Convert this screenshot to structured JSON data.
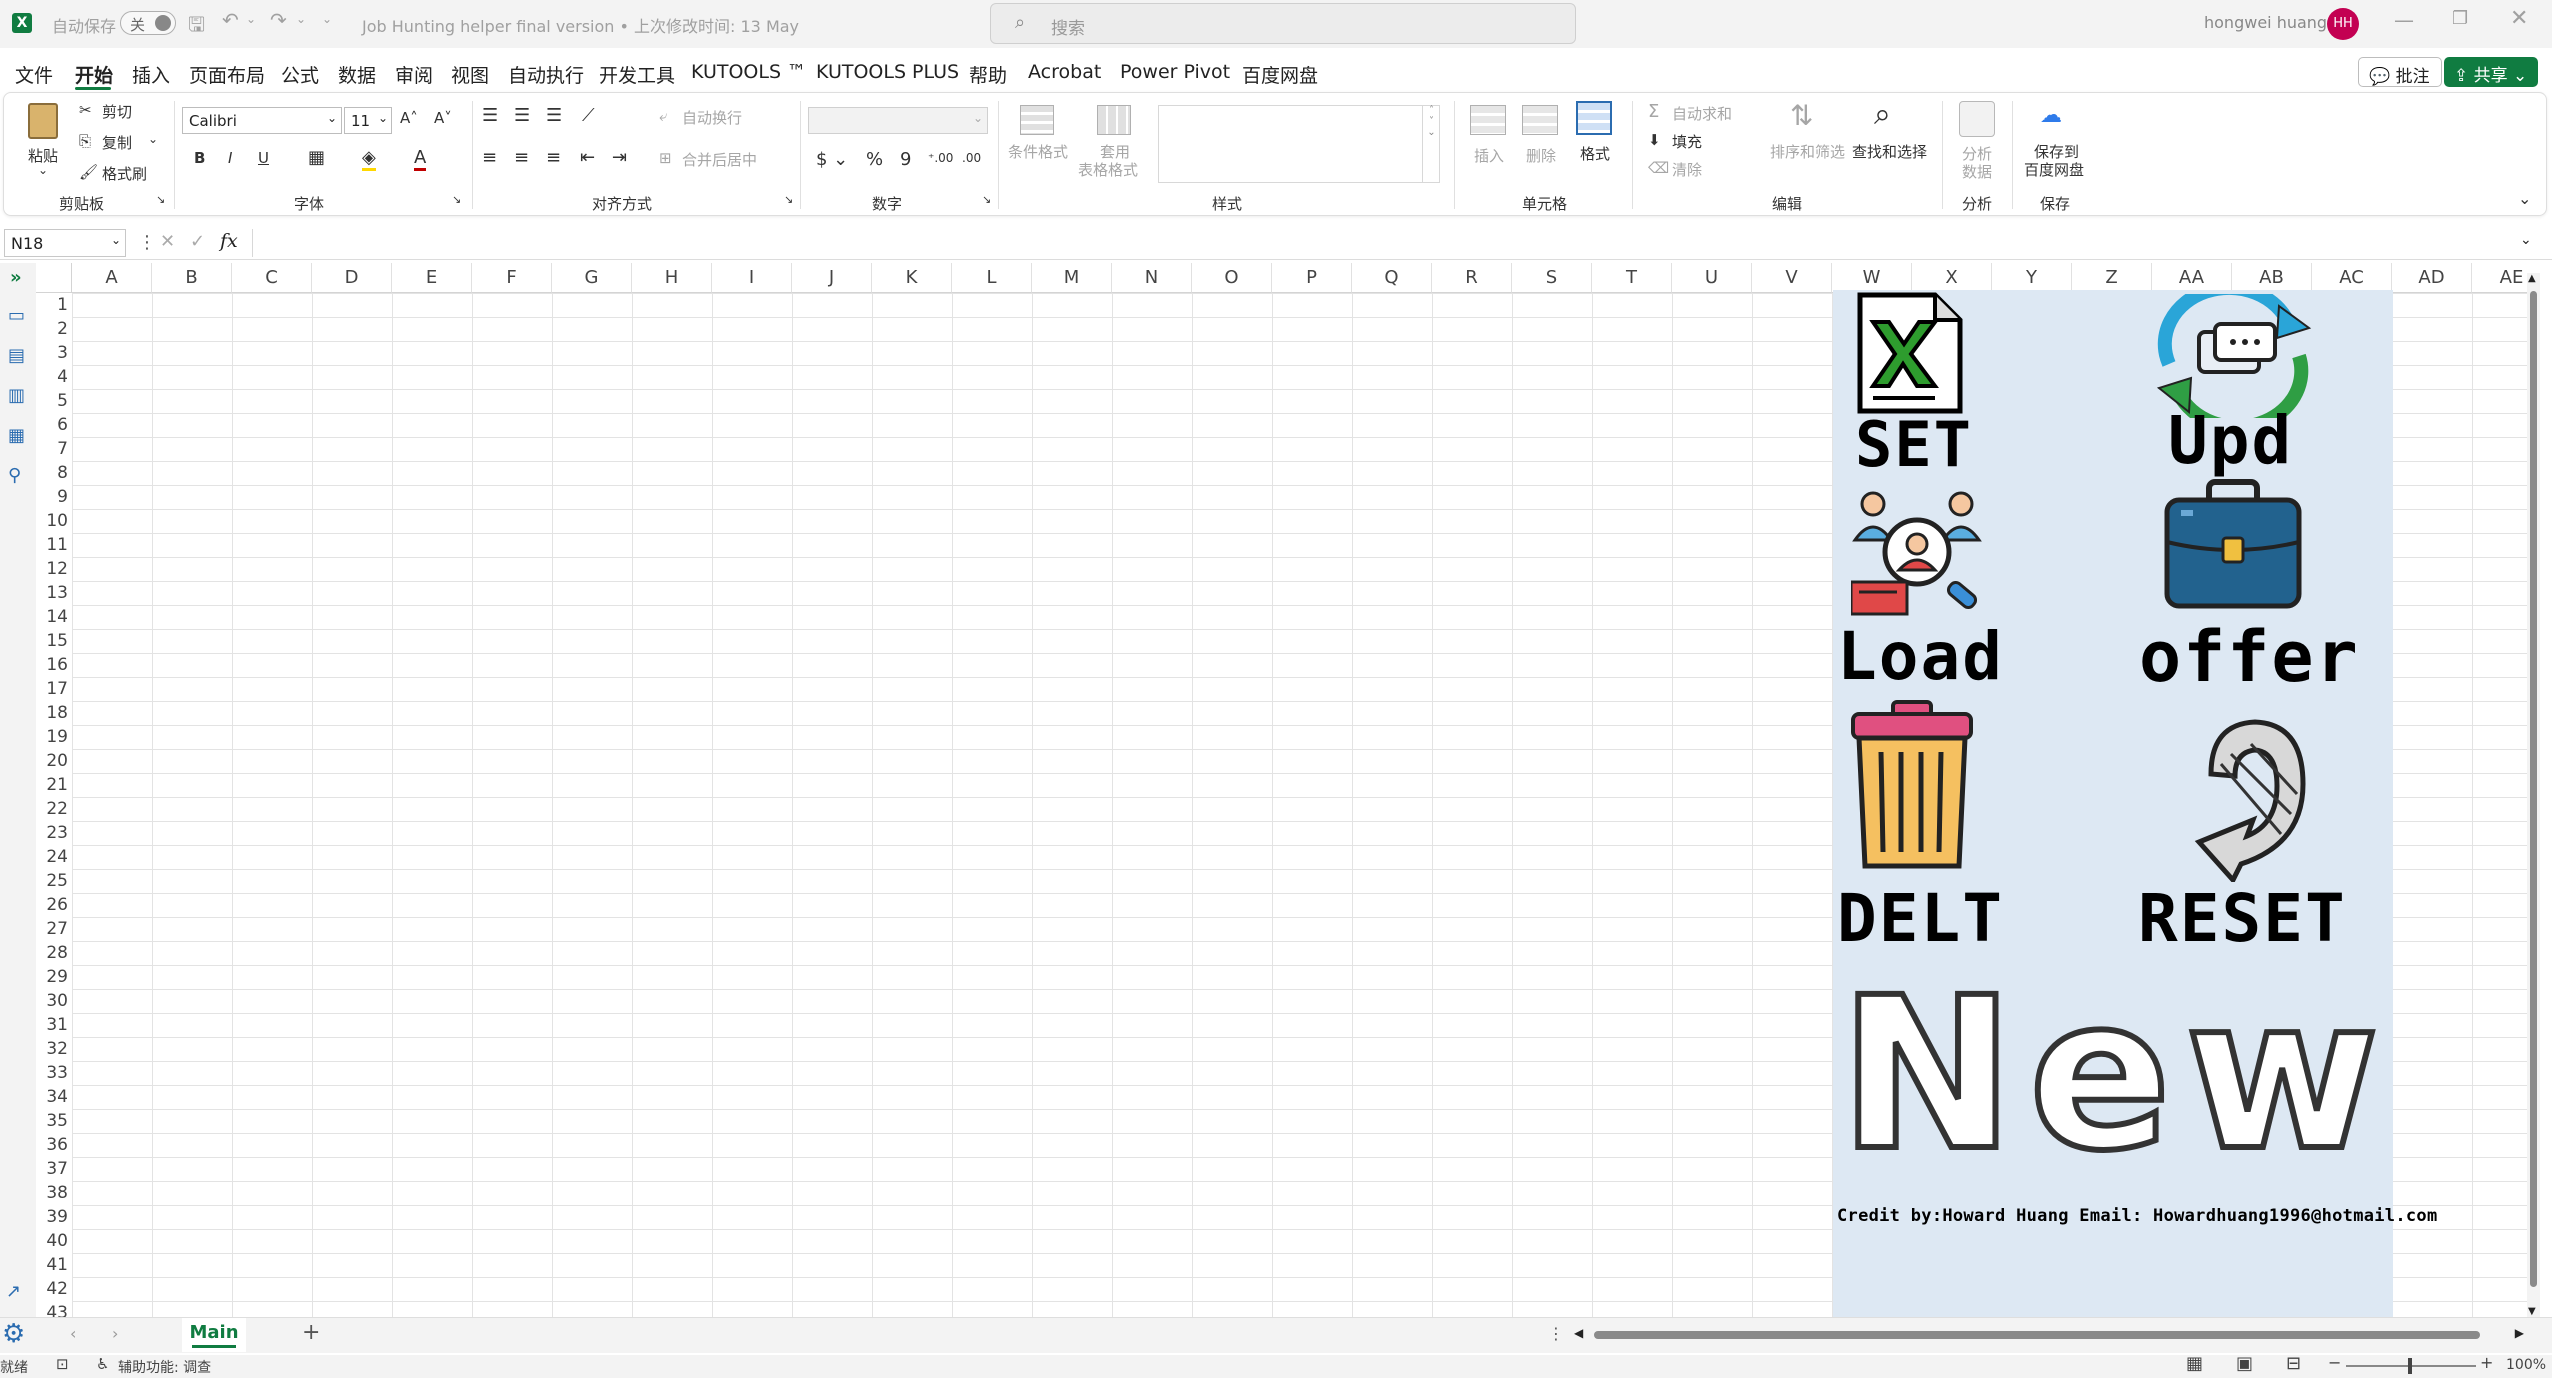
{
  "titlebar": {
    "autosave_label": "自动保存",
    "autosave_state": "关",
    "doc_title": "Job Hunting helper final version • 上次修改时间: 13 May",
    "search_placeholder": "搜索",
    "user_name": "hongwei huang",
    "user_initials": "HH",
    "accent_color": "#c30052",
    "app_icon_color": "#107c41"
  },
  "menu": {
    "items": [
      "文件",
      "开始",
      "插入",
      "页面布局",
      "公式",
      "数据",
      "审阅",
      "视图",
      "自动执行",
      "开发工具",
      "KUTOOLS ™",
      "KUTOOLS PLUS",
      "帮助",
      "Acrobat",
      "Power Pivot",
      "百度网盘"
    ],
    "active": "开始",
    "comment_button": "批注",
    "share_button": "共享",
    "share_color": "#107c41"
  },
  "ribbon": {
    "clipboard": {
      "group": "剪贴板",
      "paste": "粘贴",
      "cut": "剪切",
      "copy": "复制",
      "format_painter": "格式刷"
    },
    "font": {
      "group": "字体",
      "name": "Calibri",
      "size": "11"
    },
    "align": {
      "group": "对齐方式",
      "wrap": "自动换行",
      "merge": "合并后居中"
    },
    "number": {
      "group": "数字"
    },
    "styles": {
      "group": "样式",
      "cond": "条件格式",
      "table_a": "套用",
      "table_b": "表格格式"
    },
    "cells": {
      "group": "单元格",
      "insert": "插入",
      "delete": "删除",
      "format": "格式"
    },
    "editing": {
      "group": "编辑",
      "autosum": "自动求和",
      "fill": "填充",
      "clear": "清除",
      "sort": "排序和筛选",
      "find": "查找和选择"
    },
    "analysis": {
      "group": "分析",
      "label_a": "分析",
      "label_b": "数据"
    },
    "save": {
      "group": "保存",
      "label_a": "保存到",
      "label_b": "百度网盘"
    }
  },
  "formula": {
    "name_box": "N18",
    "fx": "fx",
    "content": ""
  },
  "columns": [
    "A",
    "B",
    "C",
    "D",
    "E",
    "F",
    "G",
    "H",
    "I",
    "J",
    "K",
    "L",
    "M",
    "N",
    "O",
    "P",
    "Q",
    "R",
    "S",
    "T",
    "U",
    "V",
    "W",
    "X",
    "Y",
    "Z",
    "AA",
    "AB",
    "AC",
    "AD",
    "AE"
  ],
  "rows": [
    "1",
    "2",
    "3",
    "4",
    "5",
    "6",
    "7",
    "8",
    "9",
    "10",
    "11",
    "12",
    "13",
    "14",
    "15",
    "16",
    "17",
    "18",
    "19",
    "20",
    "21",
    "22",
    "23",
    "24",
    "25",
    "26",
    "27",
    "28",
    "29",
    "30",
    "31",
    "32",
    "33",
    "34",
    "35",
    "36",
    "37",
    "38",
    "39",
    "40",
    "41",
    "42",
    "43"
  ],
  "panel": {
    "bg_color": "#dde8f3",
    "set": "SET",
    "upd": "Upd",
    "load": "Load",
    "offer": "offer",
    "delt": "DELT",
    "reset": "RESET",
    "new": "New",
    "credit": "Credit by:Howard Huang Email: Howardhuang1996@hotmail.com"
  },
  "sheets": {
    "active": "Main",
    "add": "+"
  },
  "status": {
    "ready": "就绪",
    "accessibility": "辅助功能: 调查",
    "zoom": "100%"
  }
}
